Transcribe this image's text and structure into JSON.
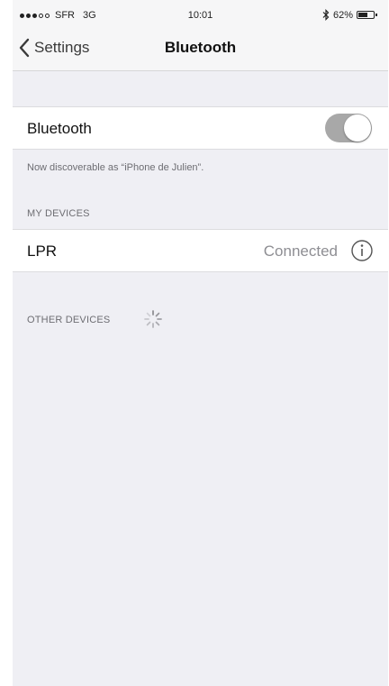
{
  "status_bar": {
    "carrier": "SFR",
    "network": "3G",
    "time": "10:01",
    "battery": "62%",
    "battery_level": 0.62,
    "signal_bars_filled": 3,
    "signal_bars_total": 5
  },
  "nav": {
    "back_label": "Settings",
    "title": "Bluetooth",
    "back_icon": "chevron-left-icon"
  },
  "bluetooth": {
    "label": "Bluetooth",
    "enabled": true,
    "discoverable_note": "Now discoverable as “iPhone de Julien”."
  },
  "my_devices": {
    "header": "MY DEVICES",
    "devices": [
      {
        "name": "LPR",
        "status": "Connected",
        "icon": "info-icon"
      }
    ]
  },
  "other_devices": {
    "header": "OTHER DEVICES",
    "icon": "loading-spinner-icon"
  },
  "colors": {
    "toggle_on": "#a8a8a8",
    "background": "#efeff4",
    "secondary_text": "#8e8e93"
  }
}
